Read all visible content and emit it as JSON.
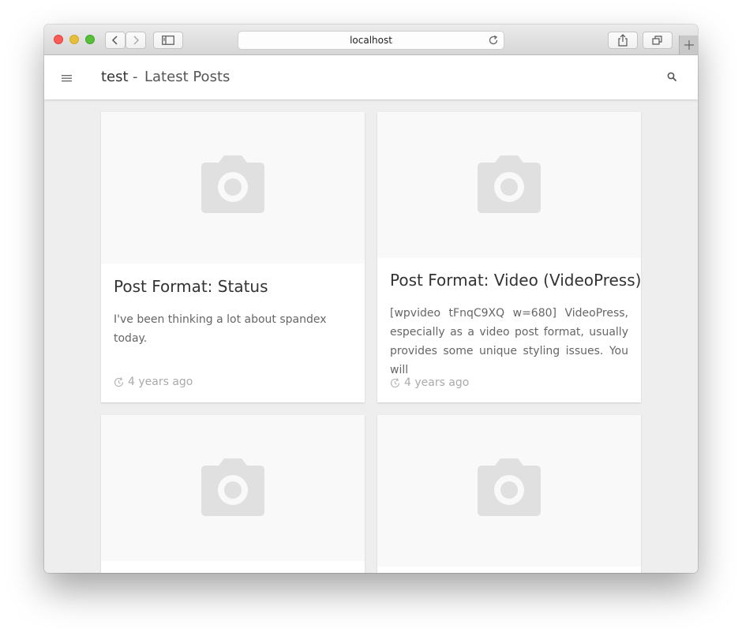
{
  "browser": {
    "address": "localhost"
  },
  "site": {
    "title": "test",
    "separator": "-",
    "page_title": "Latest Posts"
  },
  "posts": [
    {
      "title": "Post Format: Status",
      "excerpt": "I've been thinking a lot about spandex today.",
      "time": "4 years ago"
    },
    {
      "title": "Post Format: Video (VideoPress)",
      "excerpt_lines": [
        "[wpvideo tFnqC9XQ w=680] VideoPress,",
        "especially as a video post format, usually",
        "provides some unique styling issues. You will"
      ],
      "time": "4 years ago"
    }
  ],
  "icons": {
    "menu": "hamburger-icon",
    "search": "search-icon",
    "placeholder": "camera-icon",
    "time": "history-icon"
  },
  "colors": {
    "background": "#eeeeee",
    "card": "#ffffff",
    "placeholder_bg": "#f9f9f9",
    "placeholder_icon": "#e0e0e0",
    "text": "#333333",
    "muted": "#aaaaaa"
  }
}
